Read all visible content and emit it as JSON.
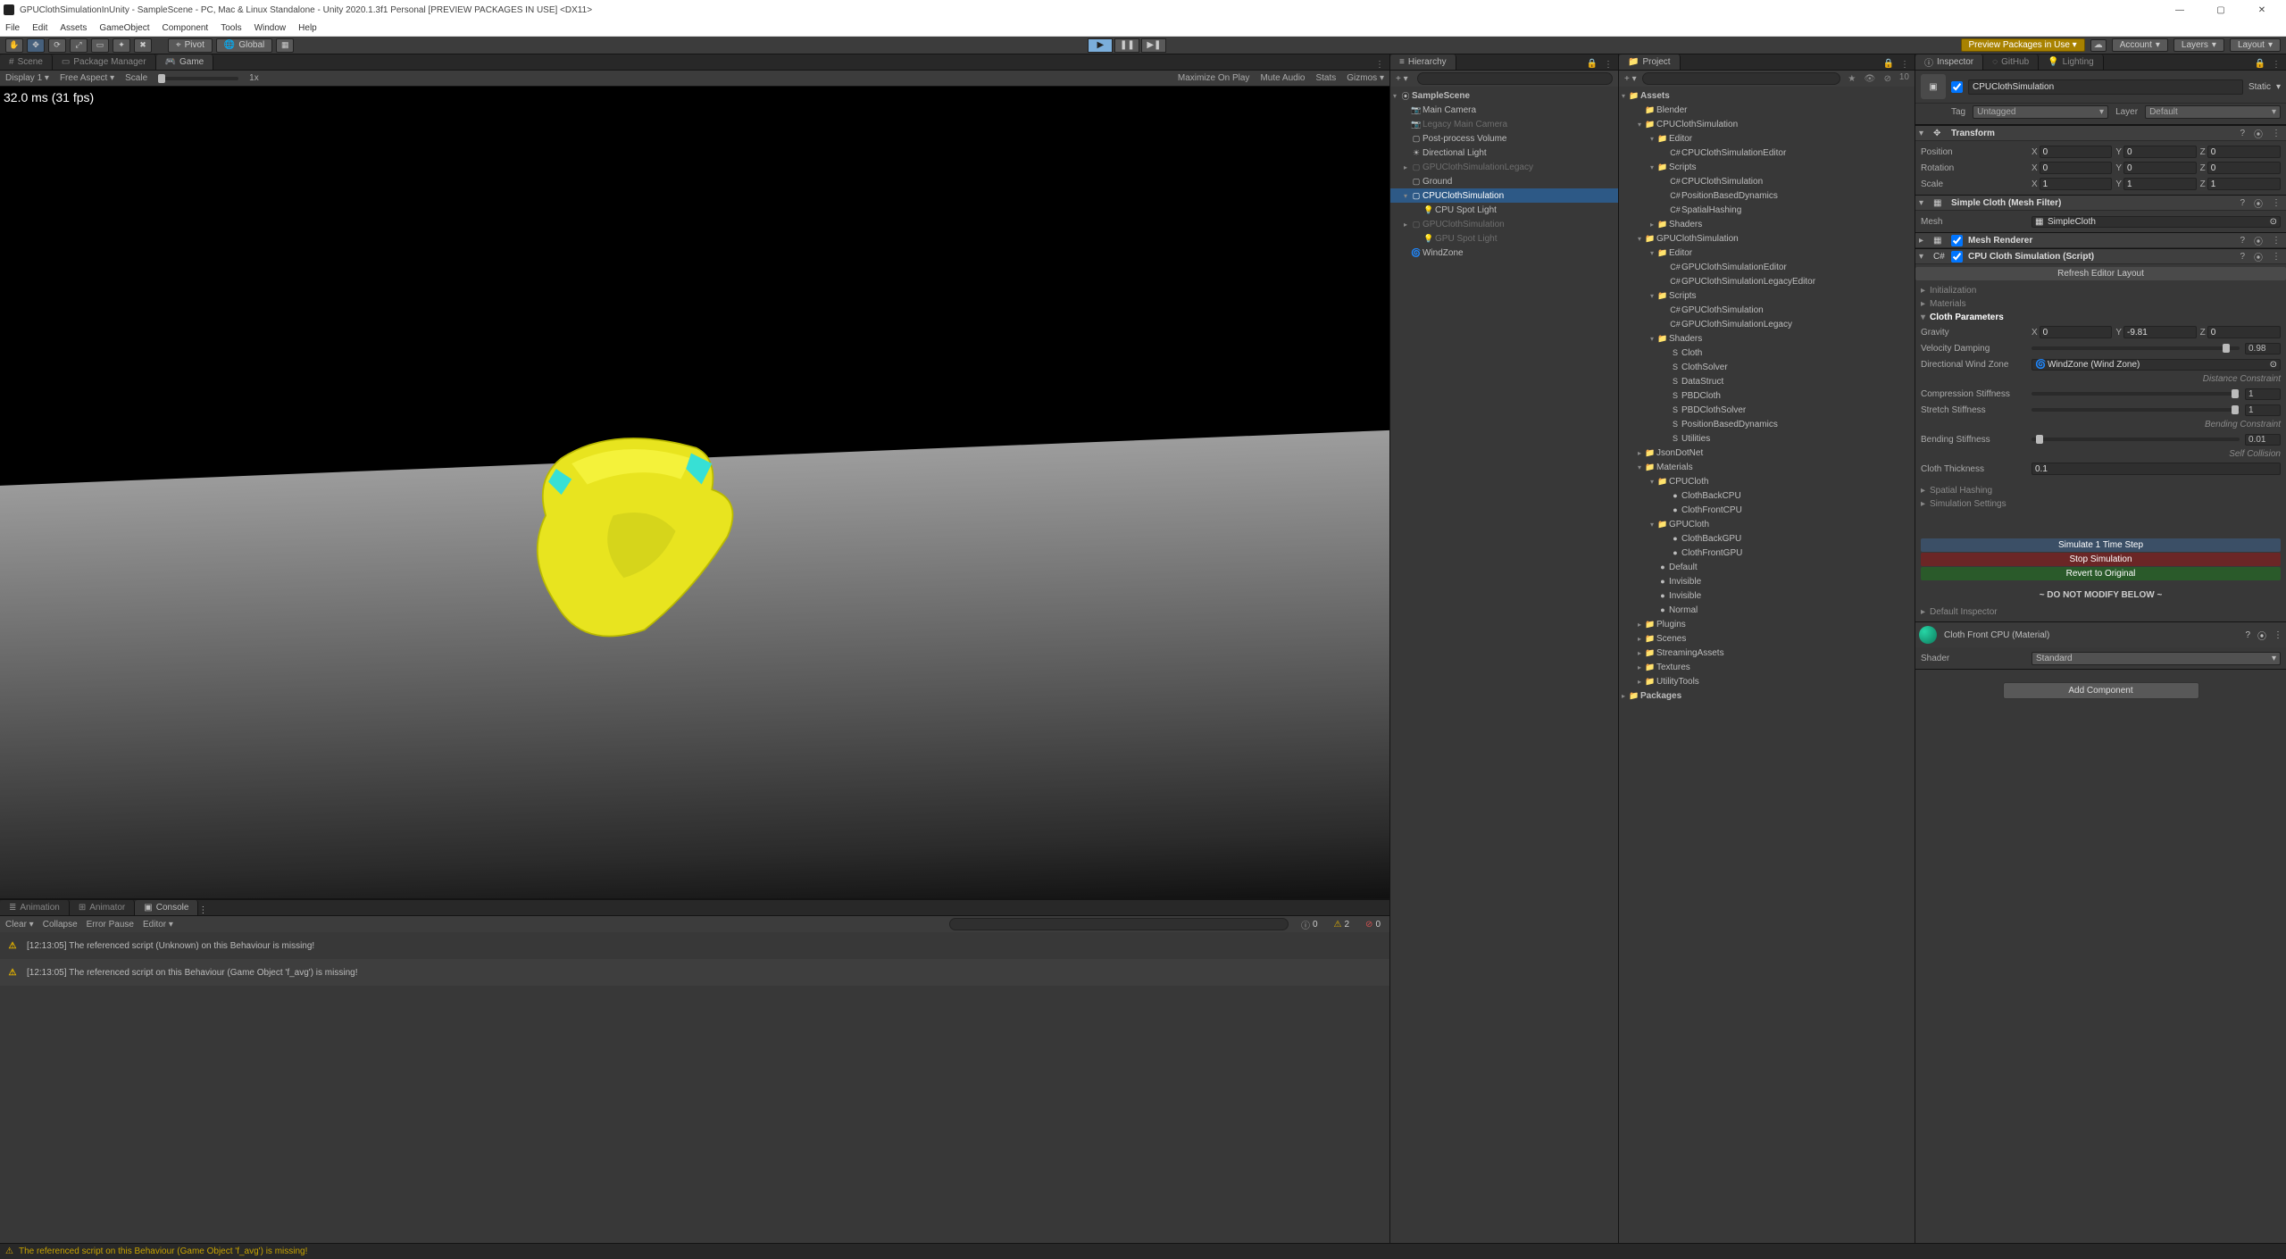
{
  "window": {
    "title": "GPUClothSimulationInUnity - SampleScene - PC, Mac & Linux Standalone - Unity 2020.1.3f1 Personal [PREVIEW PACKAGES IN USE] <DX11>"
  },
  "menu": [
    "File",
    "Edit",
    "Assets",
    "GameObject",
    "Component",
    "Tools",
    "Window",
    "Help"
  ],
  "toolbar": {
    "pivot": "Pivot",
    "global": "Global",
    "preview_badge": "Preview Packages in Use",
    "account": "Account",
    "layers": "Layers",
    "layout": "Layout"
  },
  "scene_tabs": {
    "scene": "Scene",
    "pkg": "Package Manager",
    "game": "Game"
  },
  "game_bar": {
    "display": "Display 1",
    "aspect": "Free Aspect",
    "scale_label": "Scale",
    "scale_value": "1x",
    "maximize": "Maximize On Play",
    "mute": "Mute Audio",
    "stats": "Stats",
    "gizmos": "Gizmos"
  },
  "viewport": {
    "stats": "32.0 ms (31 fps)"
  },
  "hierarchy": {
    "tab": "Hierarchy",
    "scene": "SampleScene",
    "items": [
      {
        "t": "Main Camera",
        "d": 0,
        "ico": "📷"
      },
      {
        "t": "Legacy Main Camera",
        "d": 1,
        "ico": "📷"
      },
      {
        "t": "Post-process Volume",
        "d": 0,
        "ico": "▢"
      },
      {
        "t": "Directional Light",
        "d": 0,
        "ico": "☀"
      },
      {
        "t": "GPUClothSimulationLegacy",
        "d": 1,
        "ico": "▢",
        "tw": "▸"
      },
      {
        "t": "Ground",
        "d": 0,
        "ico": "▢"
      },
      {
        "t": "CPUClothSimulation",
        "d": 0,
        "ico": "▢",
        "sel": true,
        "tw": "▾"
      },
      {
        "t": "CPU Spot Light",
        "d": 0,
        "ico": "💡",
        "indent": 1
      },
      {
        "t": "GPUClothSimulation",
        "d": 1,
        "ico": "▢",
        "tw": "▸"
      },
      {
        "t": "GPU Spot Light",
        "d": 1,
        "ico": "💡",
        "indent": 1
      },
      {
        "t": "WindZone",
        "d": 0,
        "ico": "🌀"
      }
    ]
  },
  "project": {
    "tab": "Project",
    "root": "Assets",
    "packages": "Packages",
    "tree": [
      {
        "t": "Blender",
        "i": 1,
        "ico": "📁"
      },
      {
        "t": "CPUClothSimulation",
        "i": 1,
        "ico": "📁",
        "tw": "▾"
      },
      {
        "t": "Editor",
        "i": 2,
        "ico": "📁",
        "tw": "▾"
      },
      {
        "t": "CPUClothSimulationEditor",
        "i": 3,
        "ico": "C#"
      },
      {
        "t": "Scripts",
        "i": 2,
        "ico": "📁",
        "tw": "▾"
      },
      {
        "t": "CPUClothSimulation",
        "i": 3,
        "ico": "C#"
      },
      {
        "t": "PositionBasedDynamics",
        "i": 3,
        "ico": "C#"
      },
      {
        "t": "SpatialHashing",
        "i": 3,
        "ico": "C#"
      },
      {
        "t": "Shaders",
        "i": 2,
        "ico": "📁",
        "tw": "▸"
      },
      {
        "t": "GPUClothSimulation",
        "i": 1,
        "ico": "📁",
        "tw": "▾"
      },
      {
        "t": "Editor",
        "i": 2,
        "ico": "📁",
        "tw": "▾"
      },
      {
        "t": "GPUClothSimulationEditor",
        "i": 3,
        "ico": "C#"
      },
      {
        "t": "GPUClothSimulationLegacyEditor",
        "i": 3,
        "ico": "C#"
      },
      {
        "t": "Scripts",
        "i": 2,
        "ico": "📁",
        "tw": "▾"
      },
      {
        "t": "GPUClothSimulation",
        "i": 3,
        "ico": "C#"
      },
      {
        "t": "GPUClothSimulationLegacy",
        "i": 3,
        "ico": "C#"
      },
      {
        "t": "Shaders",
        "i": 2,
        "ico": "📁",
        "tw": "▾"
      },
      {
        "t": "Cloth",
        "i": 3,
        "ico": "S"
      },
      {
        "t": "ClothSolver",
        "i": 3,
        "ico": "S"
      },
      {
        "t": "DataStruct",
        "i": 3,
        "ico": "S"
      },
      {
        "t": "PBDCloth",
        "i": 3,
        "ico": "S"
      },
      {
        "t": "PBDClothSolver",
        "i": 3,
        "ico": "S"
      },
      {
        "t": "PositionBasedDynamics",
        "i": 3,
        "ico": "S"
      },
      {
        "t": "Utilities",
        "i": 3,
        "ico": "S"
      },
      {
        "t": "JsonDotNet",
        "i": 1,
        "ico": "📁",
        "tw": "▸"
      },
      {
        "t": "Materials",
        "i": 1,
        "ico": "📁",
        "tw": "▾"
      },
      {
        "t": "CPUCloth",
        "i": 2,
        "ico": "📁",
        "tw": "▾"
      },
      {
        "t": "ClothBackCPU",
        "i": 3,
        "ico": "●"
      },
      {
        "t": "ClothFrontCPU",
        "i": 3,
        "ico": "●"
      },
      {
        "t": "GPUCloth",
        "i": 2,
        "ico": "📁",
        "tw": "▾"
      },
      {
        "t": "ClothBackGPU",
        "i": 3,
        "ico": "●"
      },
      {
        "t": "ClothFrontGPU",
        "i": 3,
        "ico": "●"
      },
      {
        "t": "Default",
        "i": 2,
        "ico": "●"
      },
      {
        "t": "Invisible",
        "i": 2,
        "ico": "●"
      },
      {
        "t": "Invisible",
        "i": 2,
        "ico": "●"
      },
      {
        "t": "Normal",
        "i": 2,
        "ico": "●"
      },
      {
        "t": "Plugins",
        "i": 1,
        "ico": "📁",
        "tw": "▸"
      },
      {
        "t": "Scenes",
        "i": 1,
        "ico": "📁",
        "tw": "▸"
      },
      {
        "t": "StreamingAssets",
        "i": 1,
        "ico": "📁",
        "tw": "▸"
      },
      {
        "t": "Textures",
        "i": 1,
        "ico": "📁",
        "tw": "▸"
      },
      {
        "t": "UtilityTools",
        "i": 1,
        "ico": "📁",
        "tw": "▸"
      }
    ]
  },
  "inspector": {
    "tab": "Inspector",
    "github": "GitHub",
    "lighting": "Lighting",
    "object_name": "CPUClothSimulation",
    "static": "Static",
    "tag_label": "Tag",
    "tag_value": "Untagged",
    "layer_label": "Layer",
    "layer_value": "Default",
    "transform": {
      "title": "Transform",
      "position": {
        "label": "Position",
        "x": "0",
        "y": "0",
        "z": "0"
      },
      "rotation": {
        "label": "Rotation",
        "x": "0",
        "y": "0",
        "z": "0"
      },
      "scale": {
        "label": "Scale",
        "x": "1",
        "y": "1",
        "z": "1"
      }
    },
    "meshfilter": {
      "title": "Simple Cloth (Mesh Filter)",
      "mesh_label": "Mesh",
      "mesh_value": "SimpleCloth"
    },
    "meshrenderer": {
      "title": "Mesh Renderer"
    },
    "script": {
      "title": "CPU Cloth Simulation (Script)",
      "refresh": "Refresh Editor Layout",
      "sections": {
        "init": "Initialization",
        "mats": "Materials",
        "cparams": "Cloth Parameters",
        "spatial": "Spatial Hashing",
        "simset": "Simulation Settings"
      },
      "gravity": {
        "label": "Gravity",
        "x": "0",
        "y": "-9.81",
        "z": "0"
      },
      "veldamp": {
        "label": "Velocity Damping",
        "val": "0.98"
      },
      "windzone": {
        "label": "Directional Wind Zone",
        "val": "WindZone (Wind Zone)"
      },
      "dist_header": "Distance Constraint",
      "comp": {
        "label": "Compression Stiffness",
        "val": "1"
      },
      "stretch": {
        "label": "Stretch Stiffness",
        "val": "1"
      },
      "bend_header": "Bending Constraint",
      "bend": {
        "label": "Bending Stiffness",
        "val": "0.01"
      },
      "self_header": "Self Collision",
      "thick": {
        "label": "Cloth Thickness",
        "val": "0.1"
      },
      "btn_sim": "Simulate 1 Time Step",
      "btn_stop": "Stop Simulation",
      "btn_revert": "Revert to Original",
      "warn": "~ DO NOT MODIFY BELOW ~",
      "def_insp": "Default Inspector"
    },
    "material": {
      "title": "Cloth Front CPU (Material)",
      "shader_label": "Shader",
      "shader_value": "Standard"
    },
    "add_component": "Add Component"
  },
  "bottom_tabs": {
    "animation": "Animation",
    "animator": "Animator",
    "console": "Console"
  },
  "console": {
    "clear": "Clear",
    "collapse": "Collapse",
    "errpause": "Error Pause",
    "editor": "Editor",
    "counts": {
      "info": "0",
      "warn": "2",
      "err": "0"
    },
    "rows": [
      "[12:13:05] The referenced script (Unknown) on this Behaviour is missing!",
      "[12:13:05] The referenced script on this Behaviour (Game Object 'f_avg') is missing!"
    ]
  },
  "statusbar": "The referenced script on this Behaviour (Game Object 'f_avg') is missing!"
}
